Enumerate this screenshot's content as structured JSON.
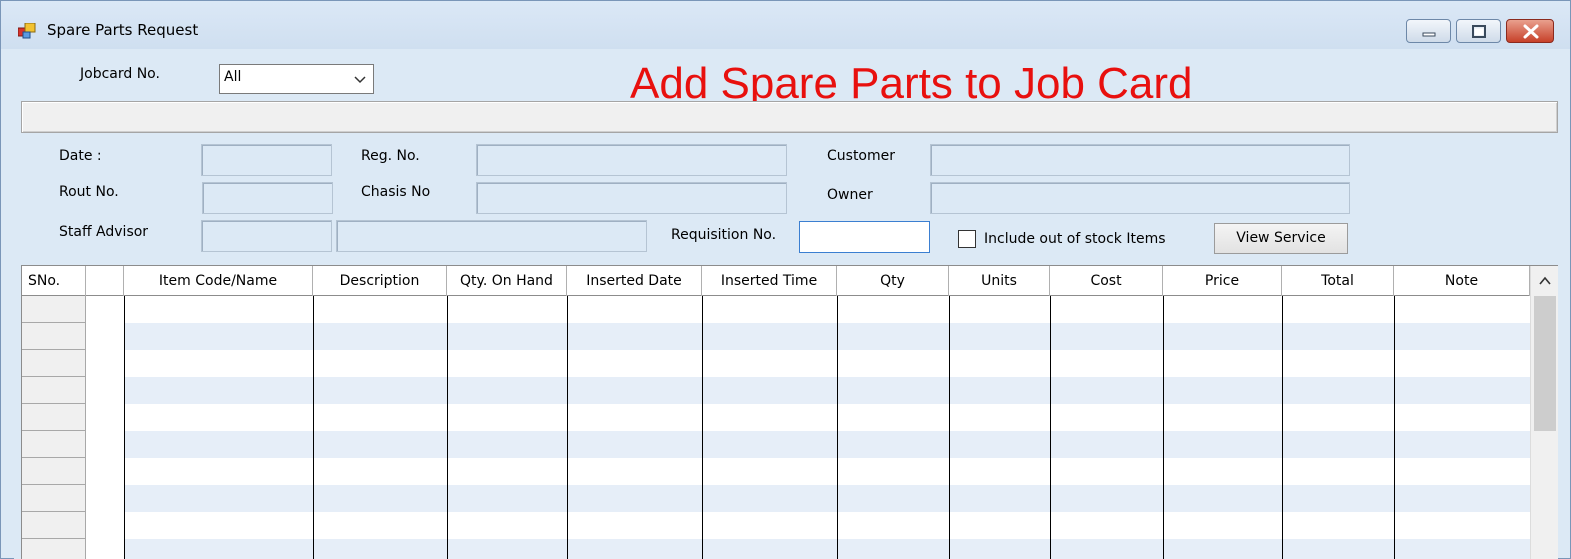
{
  "window": {
    "title": "Spare Parts Request",
    "minimize_icon": "minimize-icon",
    "maximize_icon": "maximize-icon",
    "close_icon": "close-icon"
  },
  "header": {
    "jobcard_label": "Jobcard No.",
    "jobcard_value": "All",
    "heading": "Add Spare Parts to Job Card"
  },
  "form": {
    "date_label": "Date :",
    "rout_label": "Rout No.",
    "staff_label": "Staff Advisor",
    "reg_label": "Reg. No.",
    "chasis_label": "Chasis No",
    "customer_label": "Customer",
    "owner_label": "Owner",
    "requisition_label": "Requisition No.",
    "out_of_stock_label": "Include out of stock Items",
    "out_of_stock_checked": false,
    "view_service_label": "View Service"
  },
  "grid": {
    "columns": [
      "SNo.",
      "",
      "Item Code/Name",
      "Description",
      "Qty. On Hand",
      "Inserted Date",
      "Inserted Time",
      "Qty",
      "Units",
      "Cost",
      "Price",
      "Total",
      "Note"
    ],
    "rows": []
  },
  "colors": {
    "heading": "#e8100e",
    "background": "#dce9f5",
    "row_alt": "#e6eef8"
  }
}
